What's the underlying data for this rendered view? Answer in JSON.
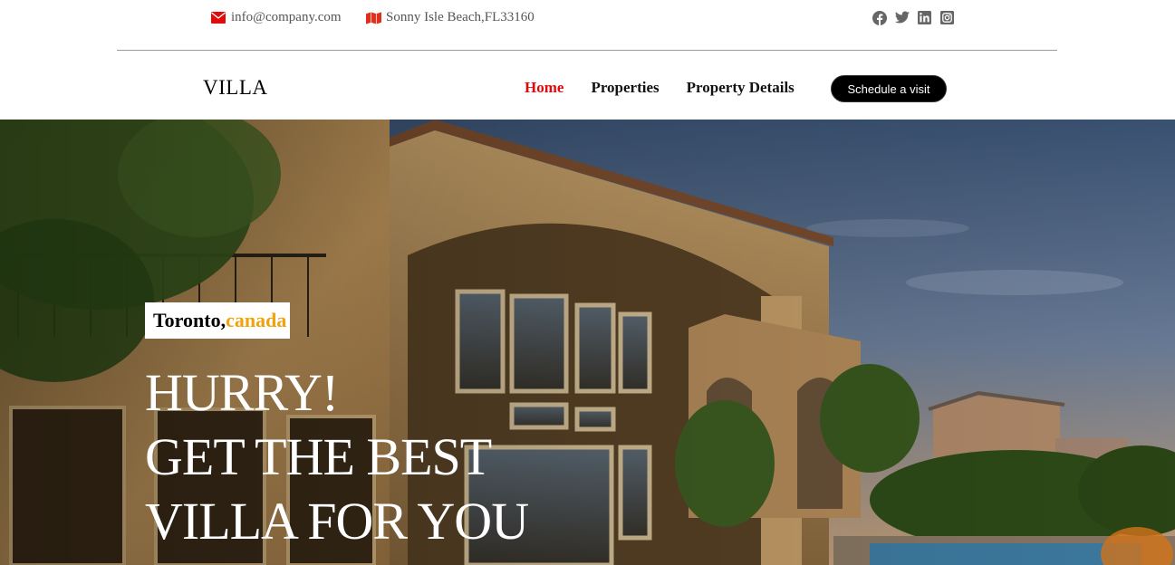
{
  "topbar": {
    "email": "info@company.com",
    "email_icon": "envelope-icon",
    "address": "Sonny Isle Beach,FL33160",
    "address_icon": "map-icon",
    "social": [
      "facebook-icon",
      "twitter-icon",
      "linkedin-icon",
      "instagram-icon"
    ]
  },
  "header": {
    "logo": "VILLA",
    "nav": [
      {
        "label": "Home",
        "active": true
      },
      {
        "label": "Properties",
        "active": false
      },
      {
        "label": "Property Details",
        "active": false
      }
    ],
    "cta_label": "Schedule a visit"
  },
  "hero": {
    "city": "Toronto,",
    "country": "canada",
    "title_lines": [
      "HURRY!",
      "GET THE BEST",
      "VILLA FOR YOU"
    ]
  },
  "colors": {
    "accent_red": "#e20a0a",
    "badge_orange": "#f3a20d",
    "cta_bg": "#000000"
  }
}
